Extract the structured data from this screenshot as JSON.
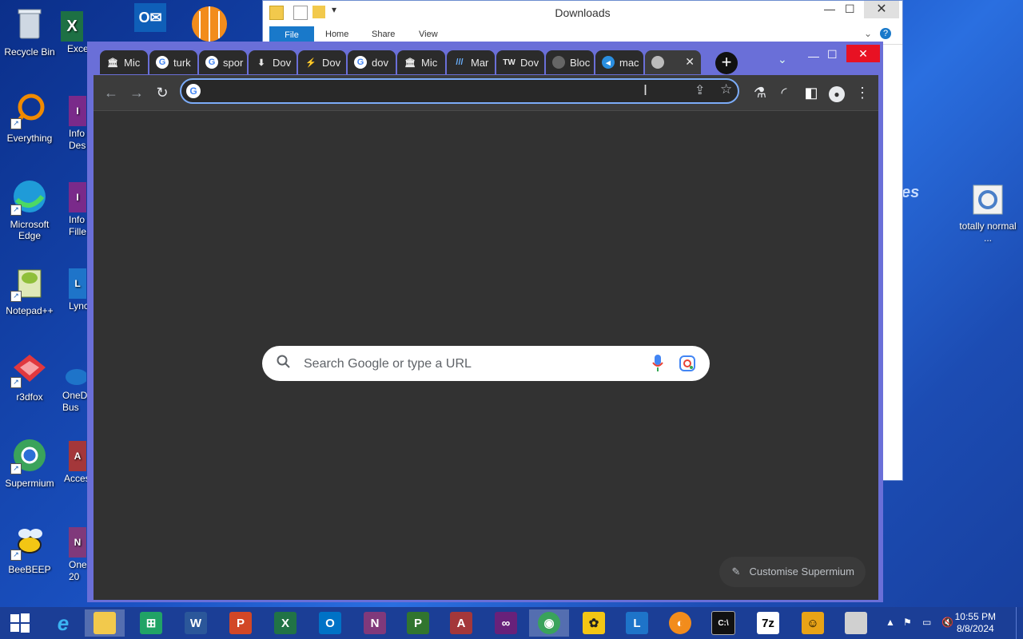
{
  "desktop": {
    "left_icons": [
      {
        "label": "Recycle Bin"
      },
      {
        "label": "Everything"
      },
      {
        "label": "Microsoft Edge"
      },
      {
        "label": "Notepad++"
      },
      {
        "label": "r3dfox"
      },
      {
        "label": "Supermium"
      },
      {
        "label": "BeeBEEP"
      }
    ],
    "second_column": [
      {
        "label": "Exce"
      },
      {
        "label": "Info Des"
      },
      {
        "label": "Info Fille"
      },
      {
        "label": "Lync"
      },
      {
        "label": "OneD Bus"
      },
      {
        "label": "Acces"
      },
      {
        "label": "One 20"
      }
    ],
    "right_icons": [
      {
        "label": "totally normal ..."
      }
    ],
    "wallpaper_text": "es"
  },
  "explorer": {
    "title": "Downloads",
    "ribbon_tabs": [
      "File",
      "Home",
      "Share",
      "View"
    ]
  },
  "browser": {
    "tabs": [
      {
        "label": "Mic",
        "icon": "museum-icon"
      },
      {
        "label": "turk",
        "icon": "google-icon"
      },
      {
        "label": "spor",
        "icon": "google-icon"
      },
      {
        "label": "Dov",
        "icon": "download-icon"
      },
      {
        "label": "Dov",
        "icon": "bolt-icon"
      },
      {
        "label": "dov",
        "icon": "google-icon"
      },
      {
        "label": "Mic",
        "icon": "museum-icon"
      },
      {
        "label": "Mar",
        "icon": "slashes-icon"
      },
      {
        "label": "Dov",
        "icon": "tw-icon"
      },
      {
        "label": "Bloc",
        "icon": "globe-icon"
      },
      {
        "label": "mac",
        "icon": "fish-icon"
      },
      {
        "label": "",
        "icon": "chrome-icon"
      }
    ],
    "omnibox_value": "",
    "search_placeholder": "Search Google or type a URL",
    "customise_label": "Customise Supermium"
  },
  "taskbar": {
    "time": "10:55 PM",
    "date": "8/8/2024",
    "apps": [
      "start",
      "ie",
      "explorer",
      "excel-green",
      "word",
      "powerpoint",
      "excel",
      "outlook",
      "onenote",
      "project",
      "access",
      "visual-studio",
      "supermium",
      "beebeep",
      "lync",
      "r3dfox",
      "cmd",
      "7zip",
      "app",
      "file"
    ]
  }
}
